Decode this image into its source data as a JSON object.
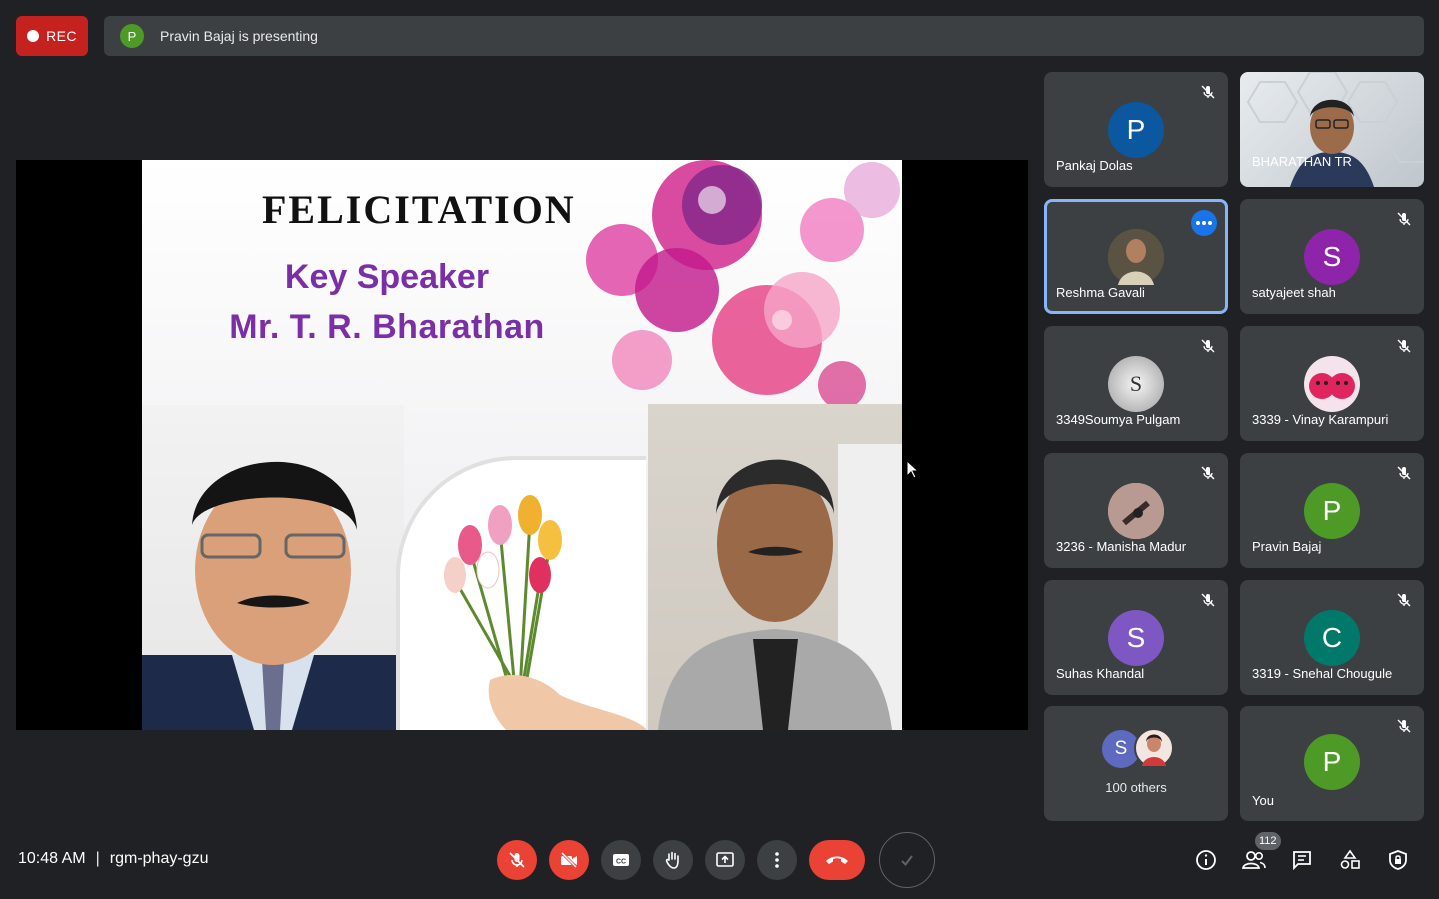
{
  "recording": {
    "label": "REC"
  },
  "presenting": {
    "initial": "P",
    "text": "Pravin Bajaj is presenting",
    "avatar_color": "#4e9a27"
  },
  "slide": {
    "title": "FELICITATION",
    "line1": "Key Speaker",
    "line2": "Mr. T. R. Bharathan",
    "text_color": "#7b2fa6"
  },
  "participants": [
    {
      "name": "Pankaj Dolas",
      "initial": "P",
      "color": "#0b57a0",
      "muted": true
    },
    {
      "name": "BHARATHAN TR",
      "video": true
    },
    {
      "name": "Reshma Gavali",
      "photo": true,
      "active": true,
      "more_menu": true
    },
    {
      "name": "satyajeet shah",
      "initial": "S",
      "color": "#8e24aa",
      "muted": true
    },
    {
      "name": "3349Soumya Pulgam",
      "initial": "S",
      "color": "#bdbdbd",
      "muted": true
    },
    {
      "name": "3339 - Vinay Karampuri",
      "photo": true,
      "muted": true
    },
    {
      "name": "3236 - Manisha Madur",
      "photo": true,
      "muted": true
    },
    {
      "name": "Pravin Bajaj",
      "initial": "P",
      "color": "#4e9a27",
      "muted": true
    },
    {
      "name": "Suhas Khandal",
      "initial": "S",
      "color": "#7e57c2",
      "muted": true
    },
    {
      "name": "3319 - Snehal Chougule",
      "initial": "C",
      "color": "#00796b",
      "muted": true
    },
    {
      "others": "100 others",
      "initial": "S",
      "color": "#5c6bc0"
    },
    {
      "name": "You",
      "initial": "P",
      "color": "#4e9a27",
      "muted": true
    }
  ],
  "footer": {
    "time": "10:48 AM",
    "separator": "|",
    "meeting_code": "rgm-phay-gzu",
    "people_count": "112"
  },
  "colors": {
    "background": "#202124",
    "tile": "#3c4043",
    "danger": "#ea4335",
    "accent": "#1a73e8"
  }
}
